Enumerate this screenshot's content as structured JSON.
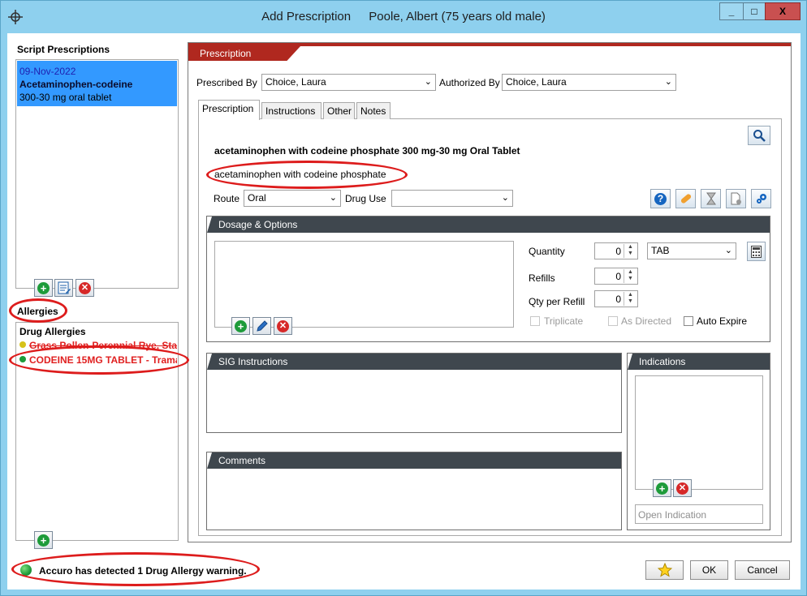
{
  "window": {
    "title": "Add Prescription",
    "patient": "Poole, Albert (75 years old male)",
    "minimize": "_",
    "maximize": "□",
    "close": "X"
  },
  "scripts": {
    "heading": "Script Prescriptions",
    "items": [
      {
        "date": "09-Nov-2022",
        "name": "Acetaminophen-codeine",
        "desc": "300-30 mg oral tablet"
      }
    ]
  },
  "allergies": {
    "heading": "Allergies",
    "group": "Drug Allergies",
    "items": [
      {
        "label": "Grass Pollen-Perennial Rye, Sta",
        "dot_color": "#d6c21a"
      },
      {
        "label": "CODEINE 15MG TABLET - Trama",
        "dot_color": "#1e9b3a"
      }
    ]
  },
  "prescription": {
    "panel_title": "Prescription",
    "prescribed_by_label": "Prescribed By",
    "prescribed_by": "Choice, Laura",
    "authorized_by_label": "Authorized By",
    "authorized_by": "Choice, Laura",
    "tabs": [
      "Prescription",
      "Instructions",
      "Other",
      "Notes"
    ],
    "drug_full": "acetaminophen with codeine phosphate 300 mg-30 mg Oral Tablet",
    "drug_generic": "acetaminophen with codeine phosphate",
    "route_label": "Route",
    "route": "Oral",
    "drug_use_label": "Drug Use",
    "drug_use": ""
  },
  "dosage": {
    "title": "Dosage & Options",
    "quantity_label": "Quantity",
    "quantity": "0",
    "unit": "TAB",
    "refills_label": "Refills",
    "refills": "0",
    "qty_per_refill_label": "Qty per Refill",
    "qty_per_refill": "0",
    "triplicate": "Triplicate",
    "as_directed": "As Directed",
    "auto_expire": "Auto Expire"
  },
  "sig": {
    "title": "SIG Instructions"
  },
  "comments": {
    "title": "Comments"
  },
  "indications": {
    "title": "Indications",
    "placeholder": "Open Indication"
  },
  "status": {
    "message": "Accuro has detected 1 Drug Allergy warning."
  },
  "buttons": {
    "ok": "OK",
    "cancel": "Cancel"
  },
  "colors": {
    "accent_red": "#b0281f",
    "selection_blue": "#3399ff",
    "window_frame": "#8ed0ee",
    "section_header": "#3f474e",
    "warning_green": "#1e9b3a"
  }
}
